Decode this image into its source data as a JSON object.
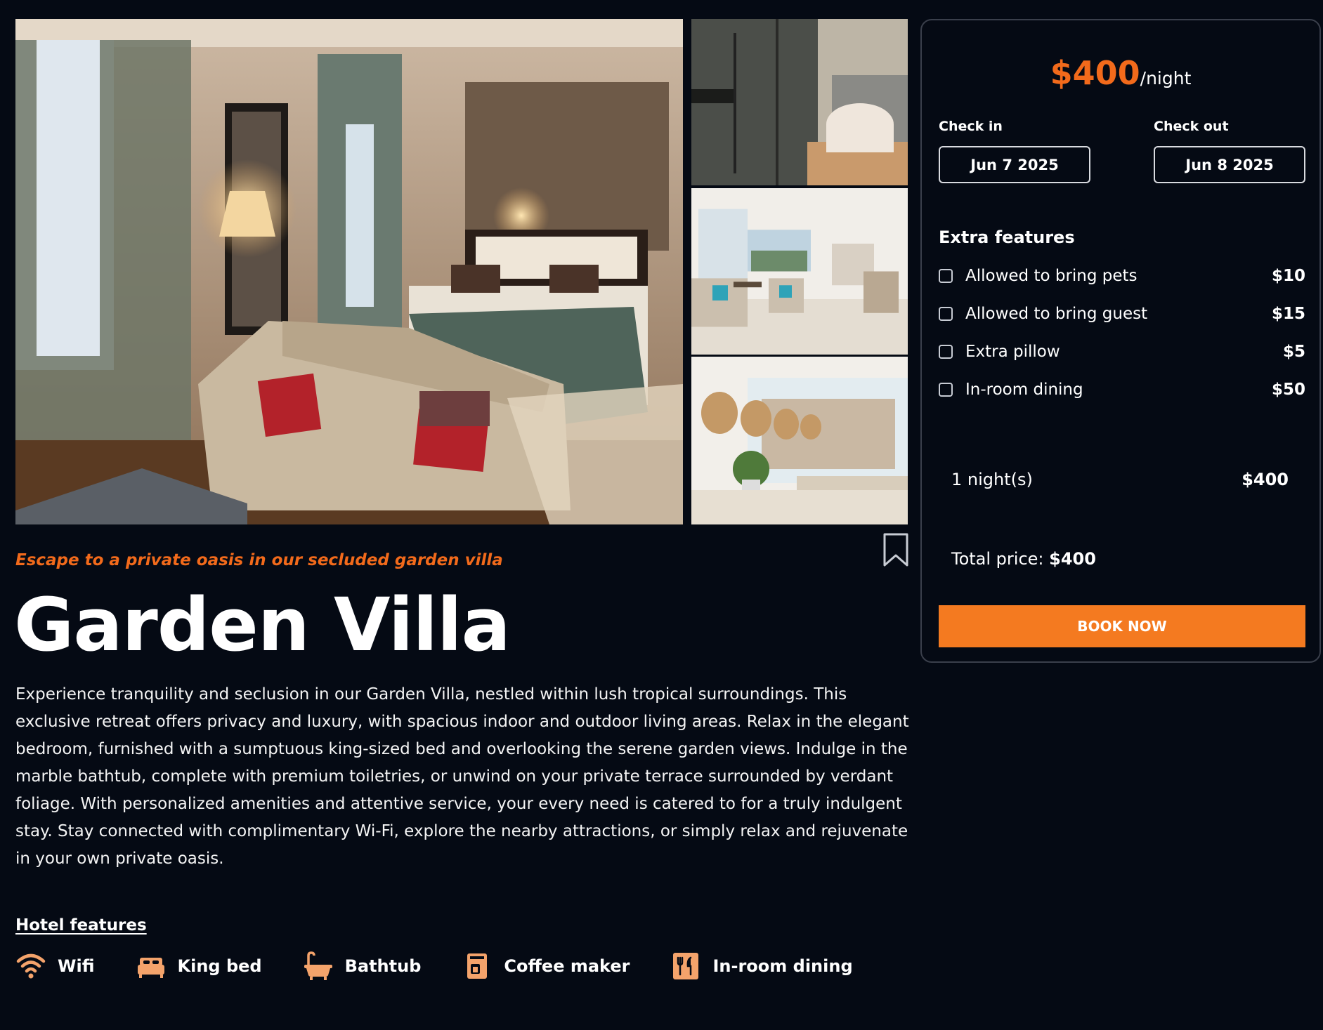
{
  "room": {
    "tagline": "Escape to a private oasis in our secluded garden villa",
    "title": "Garden Villa",
    "description": "Experience tranquility and seclusion in our Garden Villa, nestled within lush tropical surroundings. This exclusive retreat offers privacy and luxury, with spacious indoor and outdoor living areas. Relax in the elegant bedroom, furnished with a sumptuous king-sized bed and overlooking the serene garden views. Indulge in the marble bathtub, complete with premium toiletries, or unwind on your private terrace surrounded by verdant foliage. With personalized amenities and attentive service, your every need is catered to for a truly indulgent stay. Stay connected with complimentary Wi-Fi, explore the nearby attractions, or simply relax and rejuvenate in your own private oasis."
  },
  "gallery": {
    "photos": [
      "bedroom-photo",
      "bathroom-photo",
      "living-room-photo",
      "dining-room-photo"
    ]
  },
  "bookmark_icon": "bookmark-icon",
  "features": {
    "heading": "Hotel features",
    "items": [
      {
        "label": "Wifi",
        "icon": "wifi-icon"
      },
      {
        "label": "King bed",
        "icon": "bed-icon"
      },
      {
        "label": "Bathtub",
        "icon": "bathtub-icon"
      },
      {
        "label": "Coffee maker",
        "icon": "coffee-maker-icon"
      },
      {
        "label": "In-room dining",
        "icon": "dining-icon"
      }
    ]
  },
  "booking": {
    "price": "$400",
    "price_unit": "/night",
    "check_in_label": "Check in",
    "check_in_value": "Jun 7 2025",
    "check_out_label": "Check out",
    "check_out_value": "Jun 8 2025",
    "extras_heading": "Extra features",
    "extras": [
      {
        "label": "Allowed to bring pets",
        "price": "$10",
        "checked": false
      },
      {
        "label": "Allowed to bring guest",
        "price": "$15",
        "checked": false
      },
      {
        "label": "Extra pillow",
        "price": "$5",
        "checked": false
      },
      {
        "label": "In-room dining",
        "price": "$50",
        "checked": false
      }
    ],
    "nights_label": "1 night(s)",
    "nights_price": "$400",
    "total_label": "Total price:",
    "total_price": "$400",
    "book_button": "BOOK NOW"
  },
  "colors": {
    "background": "#050a14",
    "accent": "#f26a1b",
    "button": "#f47a20",
    "feature_icon": "#f4a36b"
  }
}
